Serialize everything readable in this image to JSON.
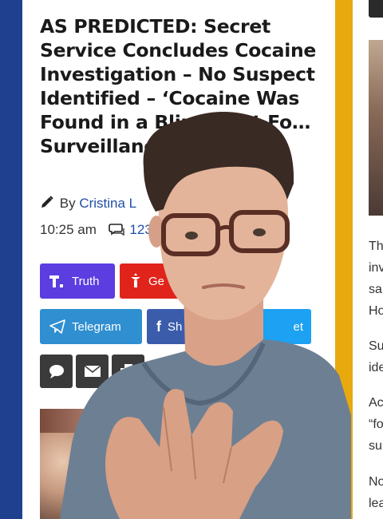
{
  "article": {
    "headline": "AS PREDICTED: Secret Service Concludes Cocaine Investigation – No Suspect Identified – ‘Cocaine Was Found in a Blind Spot Fo… Surveillanc…",
    "byline_prefix": "By",
    "author": "Cristina L",
    "time": "10:25 am",
    "comment_count": "123"
  },
  "share": {
    "truth": "Truth",
    "gettr": "Ge",
    "telegram": "Telegram",
    "facebook": "Sh",
    "tweet": "et"
  },
  "right_column": {
    "lines": [
      "Th",
      "inv",
      "sa",
      "Ho",
      "Su",
      "ide",
      "Ac",
      "“fo",
      "su",
      "No",
      "lea"
    ]
  },
  "colors": {
    "navy": "#1f3f8f",
    "gold": "#e8a90f",
    "truth": "#5b3de0",
    "gettr": "#e0241c",
    "telegram": "#2f8fd0",
    "facebook": "#3b5cab",
    "twitter": "#1da1f2",
    "link": "#1f4fa8"
  }
}
